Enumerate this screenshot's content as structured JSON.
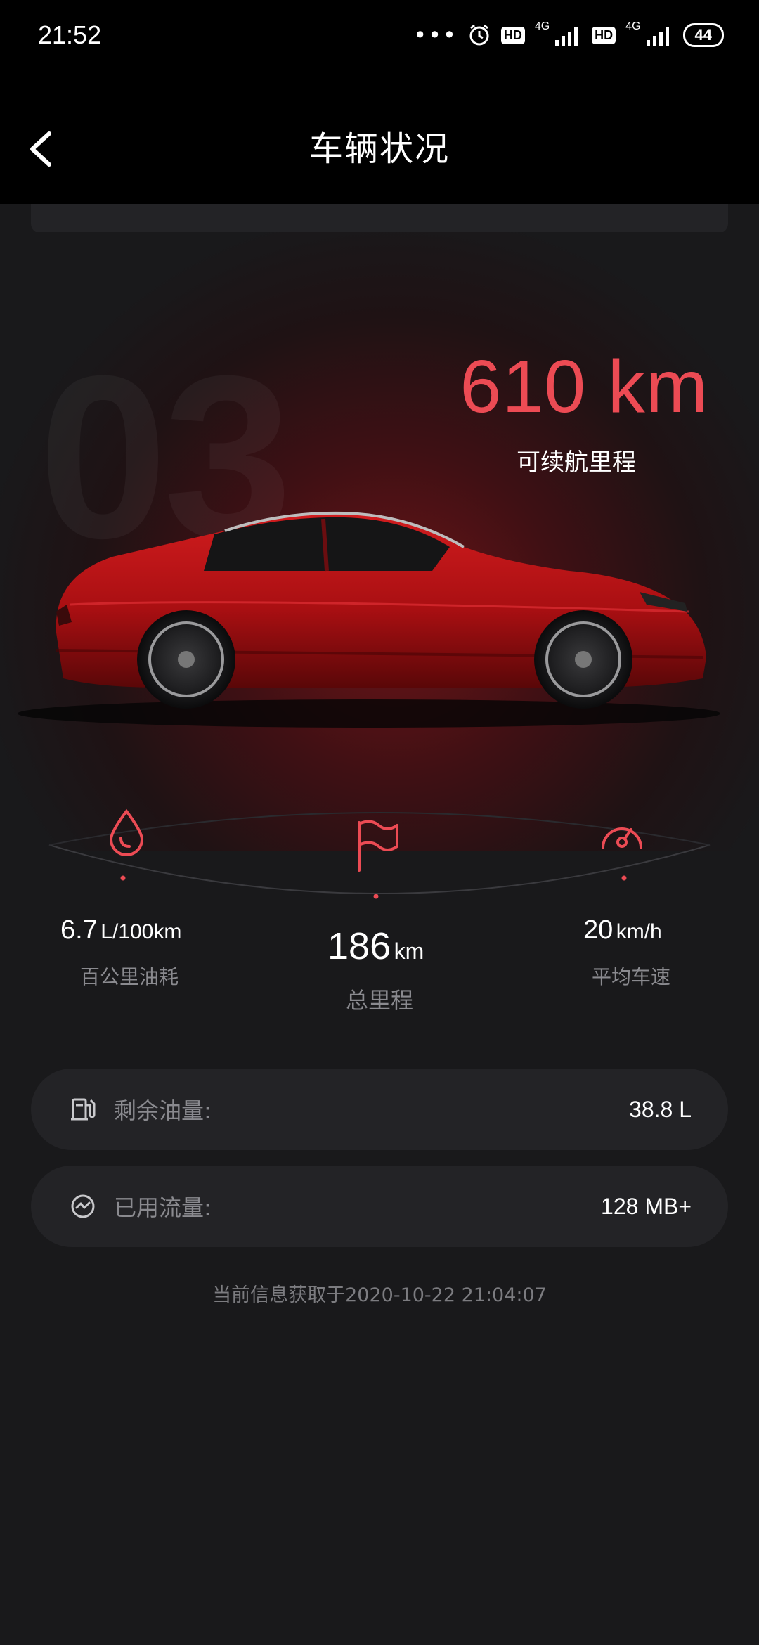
{
  "status_bar": {
    "time": "21:52",
    "battery": "44",
    "net_1": "4G",
    "net_2": "4G",
    "hd": "HD"
  },
  "header": {
    "title": "车辆状况"
  },
  "hero": {
    "watermark": "03",
    "range_value": "610 km",
    "range_label": "可续航里程"
  },
  "stats": {
    "fuel": {
      "value": "6.7",
      "unit": "L/100km",
      "label": "百公里油耗"
    },
    "mileage": {
      "value": "186",
      "unit": "km",
      "label": "总里程"
    },
    "speed": {
      "value": "20",
      "unit": "km/h",
      "label": "平均车速"
    }
  },
  "info": {
    "fuel_left": {
      "label": "剩余油量:",
      "value": "38.8 L"
    },
    "data_used": {
      "label": "已用流量:",
      "value": "128 MB+"
    }
  },
  "footer": {
    "note": "当前信息获取于2020-10-22 21:04:07"
  },
  "colors": {
    "accent": "#ec4b54",
    "background": "#19191b",
    "card": "#232326"
  }
}
